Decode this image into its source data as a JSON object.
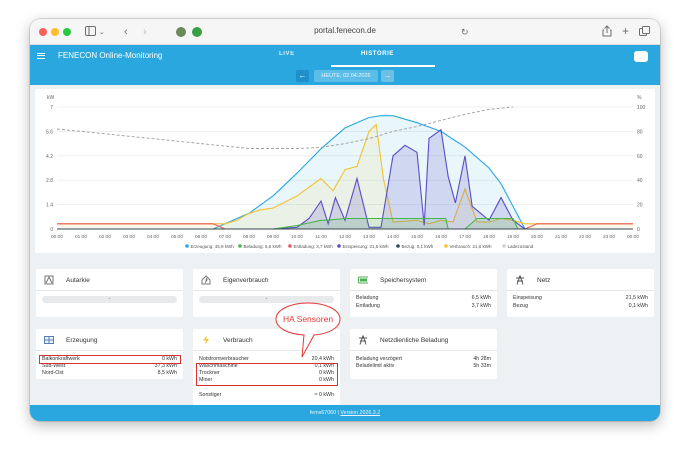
{
  "browser": {
    "url": "portal.fenecon.de"
  },
  "app": {
    "title": "FENECON Online-Monitoring",
    "tabs": [
      "LIVE",
      "HISTORIE"
    ],
    "date_label": "HEUTE, 02.04.2026"
  },
  "chart_data": {
    "type": "area",
    "x_ticks": [
      "00:00",
      "01:00",
      "02:00",
      "03:00",
      "04:00",
      "05:00",
      "06:00",
      "07:00",
      "08:00",
      "09:00",
      "10:00",
      "11:00",
      "12:00",
      "13:00",
      "14:00",
      "15:00",
      "16:00",
      "17:00",
      "18:00",
      "19:00",
      "20:00",
      "21:00",
      "22:00",
      "23:00",
      "00:00"
    ],
    "left_axis": {
      "unit": "kW",
      "ticks": [
        "0",
        "1.4",
        "2.8",
        "4.2",
        "5.6",
        "7"
      ],
      "range": [
        0,
        7
      ]
    },
    "right_axis": {
      "unit": "%",
      "ticks": [
        "0",
        "20",
        "40",
        "60",
        "80",
        "100"
      ],
      "range": [
        0,
        100
      ]
    },
    "legend": [
      "Erzeugung: 45,9 kWh",
      "Beladung: 6,5 kWh",
      "Entladung: 3,7 kWh",
      "Einspeisung: 21,5 kWh",
      "Bezug: 0,1 kWh",
      "Verbrauch: 21,6 kWh",
      "Ladezustand"
    ],
    "series": [
      {
        "name": "Erzeugung",
        "color": "#2aa7df",
        "x": [
          6.5,
          7,
          8,
          9,
          10,
          11,
          12,
          13,
          13.5,
          14,
          15,
          16,
          17,
          18,
          18.5,
          19,
          19.5
        ],
        "y": [
          0,
          0.3,
          0.9,
          1.9,
          3.2,
          4.6,
          5.8,
          6.4,
          6.5,
          6.5,
          6.1,
          5.6,
          4.7,
          3.5,
          2.6,
          1.3,
          0
        ]
      },
      {
        "name": "Beladung",
        "color": "#45b649",
        "x": [
          9,
          10,
          11,
          11.2,
          12,
          13,
          13.9,
          14,
          16.2,
          16.3,
          17,
          17.5,
          17.6,
          18,
          19,
          19.2
        ],
        "y": [
          0,
          0.2,
          0.5,
          0.5,
          0.6,
          0.6,
          0.6,
          0.6,
          0.6,
          0,
          0,
          0.6,
          0.6,
          0.6,
          0.6,
          0
        ]
      },
      {
        "name": "Entladung",
        "color": "#e85c5c",
        "x": [
          0,
          6.5,
          7,
          19.5,
          20,
          24
        ],
        "y": [
          0.3,
          0.3,
          0,
          0,
          0.3,
          0.3
        ]
      },
      {
        "name": "Einspeisung",
        "color": "#5b4cc4",
        "x": [
          9,
          10,
          10.5,
          11,
          11.3,
          11.6,
          12,
          12.5,
          13,
          13.5,
          14,
          14.5,
          15,
          15.3,
          15.5,
          16,
          16.3,
          16.6,
          17,
          17.3,
          18,
          18.5,
          19,
          19.5
        ],
        "y": [
          0,
          0.1,
          0.6,
          1.6,
          0.3,
          1.8,
          0.5,
          2.9,
          0.1,
          0.1,
          4.2,
          4.8,
          4.4,
          0.2,
          5.2,
          5.7,
          3,
          1.5,
          4.2,
          1.3,
          0.5,
          1.8,
          0.5,
          0
        ]
      },
      {
        "name": "Bezug",
        "color": "#37474f",
        "x": [
          0,
          24
        ],
        "y": [
          0,
          0
        ]
      },
      {
        "name": "Verbrauch",
        "color": "#f2c230",
        "x": [
          0,
          7,
          7.5,
          8,
          8.5,
          9,
          10,
          11,
          11.5,
          12,
          12.5,
          13,
          13.3,
          13.6,
          14,
          15,
          15.5,
          16,
          16.5,
          17,
          17.5,
          18,
          18.5,
          19,
          19.5,
          20,
          24
        ],
        "y": [
          0.3,
          0.3,
          0.5,
          0.9,
          1.1,
          1.2,
          1.9,
          2.9,
          2.2,
          3.4,
          3.6,
          5.6,
          6,
          2.9,
          0.4,
          0.5,
          0.3,
          0.5,
          0.4,
          2.3,
          0.4,
          0.4,
          0.6,
          0.5,
          0.3,
          0.3,
          0.3
        ]
      },
      {
        "name": "Ladezustand",
        "color": "#9e9e9e",
        "x": [
          0,
          2,
          4,
          6,
          8,
          9,
          10,
          11,
          12,
          13,
          14,
          15,
          16,
          17,
          18,
          19
        ],
        "y": [
          82,
          78,
          74,
          70,
          66,
          66,
          66,
          67,
          70,
          74,
          80,
          84,
          89,
          94,
          98,
          100
        ]
      }
    ]
  },
  "tiles": {
    "autarkie": {
      "title": "Autarkie",
      "value": "-"
    },
    "eigenverbrauch": {
      "title": "Eigenverbrauch",
      "value": "-"
    },
    "speicher": {
      "title": "Speichersystem",
      "rows": [
        {
          "label": "Beladung",
          "value": "6,5 kWh"
        },
        {
          "label": "Entladung",
          "value": "3,7 kWh"
        }
      ]
    },
    "netz": {
      "title": "Netz",
      "rows": [
        {
          "label": "Einspeisung",
          "value": "21,5 kWh"
        },
        {
          "label": "Bezug",
          "value": "0,1 kWh"
        }
      ]
    },
    "erzeugung": {
      "title": "Erzeugung",
      "rows": [
        {
          "label": "Balkonkraftwerk",
          "value": "0 kWh"
        },
        {
          "label": "Süd-West",
          "value": "37,3 kWh"
        },
        {
          "label": "Nord-Ost",
          "value": "8,5 kWh"
        }
      ]
    },
    "verbrauch": {
      "title": "Verbrauch",
      "rows": [
        {
          "label": "Notstromverbraucher",
          "value": "20,4 kWh"
        },
        {
          "label": "Waschmaschine",
          "value": "0,1 kWh"
        },
        {
          "label": "Trockner",
          "value": "0 kWh"
        },
        {
          "label": "Miner",
          "value": "0 kWh"
        },
        {
          "label": "Sonstiger",
          "value": "≈ 0 kWh"
        }
      ]
    },
    "netzdienlich": {
      "title": "Netzdienliche Beladung",
      "rows": [
        {
          "label": "Beladung verzögert",
          "value": "4h 28m"
        },
        {
          "label": "Beladelimit aktiv",
          "value": "5h 33m"
        }
      ]
    }
  },
  "annotation": {
    "text": "HA Sensoren",
    "color": "#e53935"
  },
  "footer": {
    "id": "fems67060",
    "separator": "|",
    "version": "Version 2026.3.2"
  }
}
